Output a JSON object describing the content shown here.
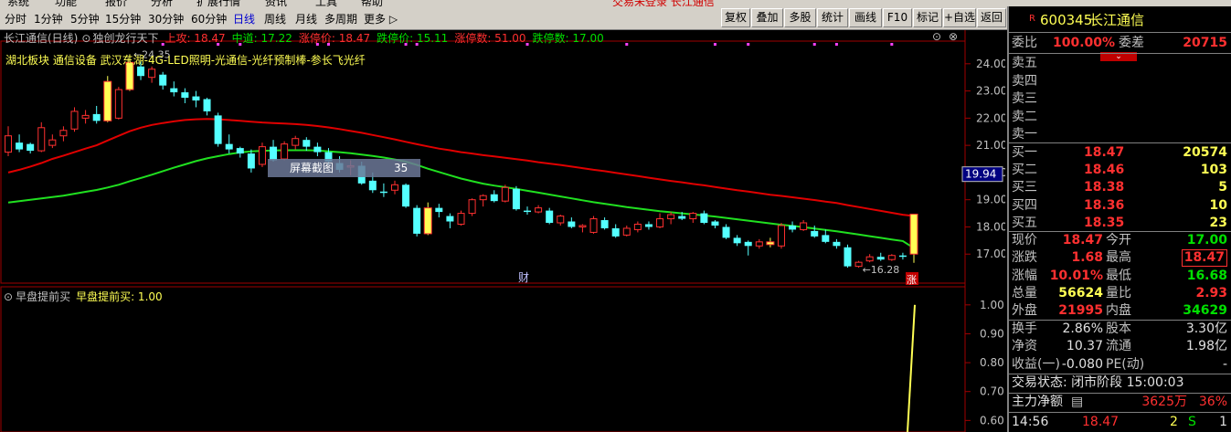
{
  "menubar": {
    "items": [
      "系统",
      "功能",
      "报价",
      "分析",
      "扩展行情",
      "资讯",
      "工具",
      "帮助"
    ],
    "status": "交易未登录  长江通信"
  },
  "periods": [
    {
      "label": "分时",
      "active": false
    },
    {
      "label": "1分钟",
      "active": false
    },
    {
      "label": "5分钟",
      "active": false
    },
    {
      "label": "15分钟",
      "active": false
    },
    {
      "label": "30分钟",
      "active": false
    },
    {
      "label": "60分钟",
      "active": false
    },
    {
      "label": "日线",
      "active": true
    },
    {
      "label": "周线",
      "active": false
    },
    {
      "label": "月线",
      "active": false
    },
    {
      "label": "多周期",
      "active": false
    },
    {
      "label": "更多 ▷",
      "active": false
    }
  ],
  "toolbar_buttons": [
    "复权",
    "叠加",
    "多股",
    "统计",
    "画线",
    "F10",
    "标记",
    "+自选",
    "返回"
  ],
  "main_panel": {
    "title": "长江通信(日线)",
    "indicator_name": "独创龙行天下",
    "indicators": [
      {
        "label": "上攻: 18.47",
        "color": "#ff3030"
      },
      {
        "label": "中道: 17.22",
        "color": "#00e000"
      },
      {
        "label": "涨停价: 18.47",
        "color": "#ff3030"
      },
      {
        "label": "跌停价: 15.11",
        "color": "#00e000"
      },
      {
        "label": "涨停数: 51.00",
        "color": "#ff3030"
      },
      {
        "label": "跌停数: 17.00",
        "color": "#00e000"
      }
    ],
    "concepts": "湖北板块    通信设备    武汉东湖-4G-LED照明-光通信-光纤预制棒-参长飞光纤",
    "high_label": "24.35",
    "low_label": "16.28",
    "current_price_tag": "19.94",
    "screenshot_tip": "屏幕截图",
    "screenshot_num": "35",
    "cai_marker": "财",
    "zhang_marker": "涨"
  },
  "sub_panel": {
    "title": "早盘提前买",
    "value_label": "早盘提前买: 1.00"
  },
  "chart_data": {
    "type": "candlestick",
    "main_y_ticks": [
      "24.00",
      "23.00",
      "22.00",
      "21.00",
      "20.00",
      "19.00",
      "18.00",
      "17.00"
    ],
    "main_ylim": [
      16.0,
      24.8
    ],
    "sub_y_ticks": [
      "1.00",
      "0.90",
      "0.80",
      "0.70",
      "0.60"
    ],
    "sub_ylim": [
      0.56,
      1.05
    ],
    "candles": [
      [
        20.75,
        21.7,
        20.6,
        21.35
      ],
      [
        21.1,
        21.4,
        20.75,
        20.85
      ],
      [
        21.05,
        21.1,
        20.7,
        20.8
      ],
      [
        20.8,
        21.85,
        20.75,
        21.65
      ],
      [
        21.0,
        21.4,
        20.9,
        21.2
      ],
      [
        21.35,
        21.7,
        21.15,
        21.55
      ],
      [
        21.6,
        22.4,
        21.5,
        22.25
      ],
      [
        22.0,
        22.3,
        21.8,
        22.1
      ],
      [
        22.15,
        22.45,
        21.8,
        21.9
      ],
      [
        21.9,
        23.55,
        21.85,
        23.35
      ],
      [
        22.0,
        23.15,
        21.95,
        23.05
      ],
      [
        23.05,
        24.35,
        23.0,
        24.05
      ],
      [
        23.9,
        24.1,
        23.4,
        23.55
      ],
      [
        23.5,
        23.9,
        23.3,
        23.8
      ],
      [
        23.6,
        23.7,
        23.05,
        23.2
      ],
      [
        23.1,
        23.35,
        22.8,
        22.95
      ],
      [
        22.95,
        23.1,
        22.55,
        22.75
      ],
      [
        22.8,
        23.0,
        22.4,
        22.65
      ],
      [
        22.7,
        22.75,
        22.1,
        22.25
      ],
      [
        22.1,
        22.2,
        20.95,
        21.05
      ],
      [
        21.05,
        21.4,
        20.7,
        20.85
      ],
      [
        20.9,
        20.95,
        20.55,
        20.7
      ],
      [
        20.7,
        20.85,
        20.0,
        20.15
      ],
      [
        20.3,
        21.1,
        20.2,
        20.95
      ],
      [
        20.95,
        21.2,
        20.4,
        20.45
      ],
      [
        20.5,
        21.15,
        20.45,
        21.05
      ],
      [
        21.0,
        21.35,
        20.85,
        21.25
      ],
      [
        21.2,
        21.3,
        20.8,
        20.95
      ],
      [
        20.95,
        21.1,
        20.6,
        20.75
      ],
      [
        20.75,
        20.9,
        20.3,
        20.4
      ],
      [
        20.35,
        20.6,
        20.0,
        20.1
      ],
      [
        20.2,
        20.45,
        19.9,
        20.25
      ],
      [
        20.25,
        20.4,
        19.55,
        19.6
      ],
      [
        19.7,
        20.0,
        19.25,
        19.35
      ],
      [
        19.3,
        19.6,
        19.1,
        19.25
      ],
      [
        19.35,
        19.7,
        19.2,
        19.55
      ],
      [
        19.55,
        19.6,
        18.7,
        18.75
      ],
      [
        18.7,
        18.8,
        17.65,
        17.75
      ],
      [
        17.75,
        18.9,
        17.7,
        18.7
      ],
      [
        18.7,
        18.85,
        18.35,
        18.55
      ],
      [
        18.4,
        18.5,
        17.95,
        18.2
      ],
      [
        18.1,
        18.6,
        18.05,
        18.5
      ],
      [
        18.5,
        19.05,
        18.4,
        19.0
      ],
      [
        19.0,
        19.2,
        18.75,
        19.15
      ],
      [
        19.2,
        19.35,
        18.9,
        18.95
      ],
      [
        18.95,
        19.55,
        18.9,
        19.45
      ],
      [
        19.4,
        19.5,
        18.6,
        18.65
      ],
      [
        18.6,
        18.75,
        18.45,
        18.55
      ],
      [
        18.55,
        18.8,
        18.5,
        18.7
      ],
      [
        18.6,
        18.7,
        18.1,
        18.15
      ],
      [
        18.15,
        18.45,
        18.05,
        18.4
      ],
      [
        18.2,
        18.35,
        17.95,
        18.0
      ],
      [
        18.0,
        18.1,
        17.8,
        18.05
      ],
      [
        17.8,
        18.4,
        17.75,
        18.3
      ],
      [
        18.25,
        18.35,
        17.9,
        17.95
      ],
      [
        17.95,
        18.1,
        17.6,
        17.65
      ],
      [
        17.7,
        18.05,
        17.65,
        17.95
      ],
      [
        17.9,
        18.2,
        17.8,
        18.1
      ],
      [
        18.1,
        18.2,
        17.9,
        18.0
      ],
      [
        18.0,
        18.5,
        17.95,
        18.3
      ],
      [
        18.3,
        18.55,
        18.1,
        18.45
      ],
      [
        18.4,
        18.55,
        18.25,
        18.3
      ],
      [
        18.3,
        18.55,
        18.15,
        18.5
      ],
      [
        18.5,
        18.6,
        18.1,
        18.15
      ],
      [
        18.2,
        18.25,
        17.95,
        18.05
      ],
      [
        18.0,
        18.1,
        17.55,
        17.6
      ],
      [
        17.6,
        17.7,
        17.3,
        17.4
      ],
      [
        17.45,
        17.5,
        16.95,
        17.3
      ],
      [
        17.3,
        17.55,
        17.2,
        17.45
      ],
      [
        17.45,
        17.6,
        17.25,
        17.35
      ],
      [
        17.3,
        18.15,
        17.2,
        18.05
      ],
      [
        18.05,
        18.2,
        17.8,
        17.9
      ],
      [
        17.9,
        18.25,
        17.85,
        18.15
      ],
      [
        17.85,
        18.05,
        17.6,
        17.65
      ],
      [
        17.7,
        17.9,
        17.4,
        17.45
      ],
      [
        17.45,
        17.55,
        17.2,
        17.3
      ],
      [
        17.25,
        17.35,
        16.5,
        16.55
      ],
      [
        16.55,
        16.75,
        16.5,
        16.7
      ],
      [
        16.75,
        17.0,
        16.7,
        16.9
      ],
      [
        16.9,
        17.05,
        16.75,
        16.8
      ],
      [
        16.8,
        17.0,
        16.75,
        16.95
      ],
      [
        16.95,
        17.05,
        16.8,
        16.9
      ],
      [
        17.0,
        18.47,
        16.68,
        18.47
      ]
    ],
    "limit_up_days": [
      9,
      11,
      38,
      69,
      82
    ],
    "limit_down_days": [
      19,
      29,
      36,
      37,
      64,
      75
    ],
    "upper_line": [
      20.0,
      20.1,
      20.22,
      20.35,
      20.5,
      20.62,
      20.75,
      20.88,
      21.0,
      21.18,
      21.35,
      21.52,
      21.65,
      21.75,
      21.82,
      21.88,
      21.93,
      21.96,
      21.97,
      21.96,
      21.93,
      21.9,
      21.87,
      21.84,
      21.82,
      21.8,
      21.78,
      21.75,
      21.71,
      21.66,
      21.6,
      21.53,
      21.46,
      21.38,
      21.3,
      21.22,
      21.13,
      21.04,
      20.96,
      20.88,
      20.82,
      20.75,
      20.7,
      20.64,
      20.59,
      20.54,
      20.49,
      20.44,
      20.38,
      20.33,
      20.28,
      20.22,
      20.16,
      20.1,
      20.05,
      19.99,
      19.93,
      19.87,
      19.81,
      19.75,
      19.69,
      19.64,
      19.58,
      19.53,
      19.47,
      19.41,
      19.35,
      19.3,
      19.24,
      19.18,
      19.14,
      19.09,
      19.04,
      18.99,
      18.93,
      18.88,
      18.8,
      18.73,
      18.66,
      18.59,
      18.52,
      18.45,
      18.4
    ],
    "mid_line": [
      18.9,
      18.95,
      19.0,
      19.05,
      19.1,
      19.15,
      19.22,
      19.29,
      19.36,
      19.45,
      19.55,
      19.68,
      19.8,
      19.92,
      20.05,
      20.18,
      20.3,
      20.42,
      20.52,
      20.6,
      20.68,
      20.74,
      20.78,
      20.8,
      20.81,
      20.82,
      20.82,
      20.82,
      20.81,
      20.78,
      20.75,
      20.71,
      20.66,
      20.61,
      20.55,
      20.48,
      20.4,
      20.28,
      20.14,
      20.02,
      19.9,
      19.78,
      19.68,
      19.59,
      19.52,
      19.46,
      19.4,
      19.33,
      19.26,
      19.19,
      19.12,
      19.05,
      18.98,
      18.91,
      18.85,
      18.79,
      18.73,
      18.68,
      18.63,
      18.58,
      18.54,
      18.5,
      18.46,
      18.42,
      18.38,
      18.33,
      18.28,
      18.23,
      18.18,
      18.13,
      18.08,
      18.04,
      17.99,
      17.94,
      17.89,
      17.84,
      17.78,
      17.72,
      17.66,
      17.6,
      17.54,
      17.48,
      17.22
    ],
    "sub_series": [
      0.0,
      1.0
    ]
  },
  "info_panel": {
    "code": "600345",
    "name": "长江通信",
    "r_badge": "R",
    "weibi_label": "委比",
    "weibi_value": "100.00%",
    "weicha_label": "委差",
    "weicha_value": "20715",
    "sell": [
      {
        "label": "卖五",
        "price": "",
        "vol": ""
      },
      {
        "label": "卖四",
        "price": "",
        "vol": ""
      },
      {
        "label": "卖三",
        "price": "",
        "vol": ""
      },
      {
        "label": "卖二",
        "price": "",
        "vol": ""
      },
      {
        "label": "卖一",
        "price": "",
        "vol": ""
      }
    ],
    "buy": [
      {
        "label": "买一",
        "price": "18.47",
        "vol": "20574"
      },
      {
        "label": "买二",
        "price": "18.46",
        "vol": "103"
      },
      {
        "label": "买三",
        "price": "18.38",
        "vol": "5"
      },
      {
        "label": "买四",
        "price": "18.36",
        "vol": "10"
      },
      {
        "label": "买五",
        "price": "18.35",
        "vol": "23"
      }
    ],
    "stats": [
      {
        "l1": "现价",
        "v1": "18.47",
        "c1": "red",
        "l2": "今开",
        "v2": "17.00",
        "c2": "green"
      },
      {
        "l1": "涨跌",
        "v1": "1.68",
        "c1": "red",
        "l2": "最高",
        "v2": "18.47",
        "c2": "red"
      },
      {
        "l1": "涨幅",
        "v1": "10.01%",
        "c1": "red",
        "l2": "最低",
        "v2": "16.68",
        "c2": "green"
      },
      {
        "l1": "总量",
        "v1": "56624",
        "c1": "yellow",
        "l2": "量比",
        "v2": "2.93",
        "c2": "red"
      },
      {
        "l1": "外盘",
        "v1": "21995",
        "c1": "red",
        "l2": "内盘",
        "v2": "34629",
        "c2": "green"
      }
    ],
    "stats2": [
      {
        "l1": "换手",
        "v1": "2.86%",
        "l2": "股本",
        "v2": "3.30亿"
      },
      {
        "l1": "净资",
        "v1": "10.37",
        "l2": "流通",
        "v2": "1.98亿"
      },
      {
        "l1": "收益(一)",
        "v1": "-0.080",
        "l2": "PE(动)",
        "v2": "-"
      }
    ],
    "trade_status": "交易状态: 闭市阶段 15:00:03",
    "net_label": "主力净额",
    "net_value": "3625万",
    "net_pct": "36%",
    "tick": {
      "time": "14:56",
      "price": "18.47",
      "vol": "2",
      "dir": "S",
      "num": "1"
    }
  }
}
